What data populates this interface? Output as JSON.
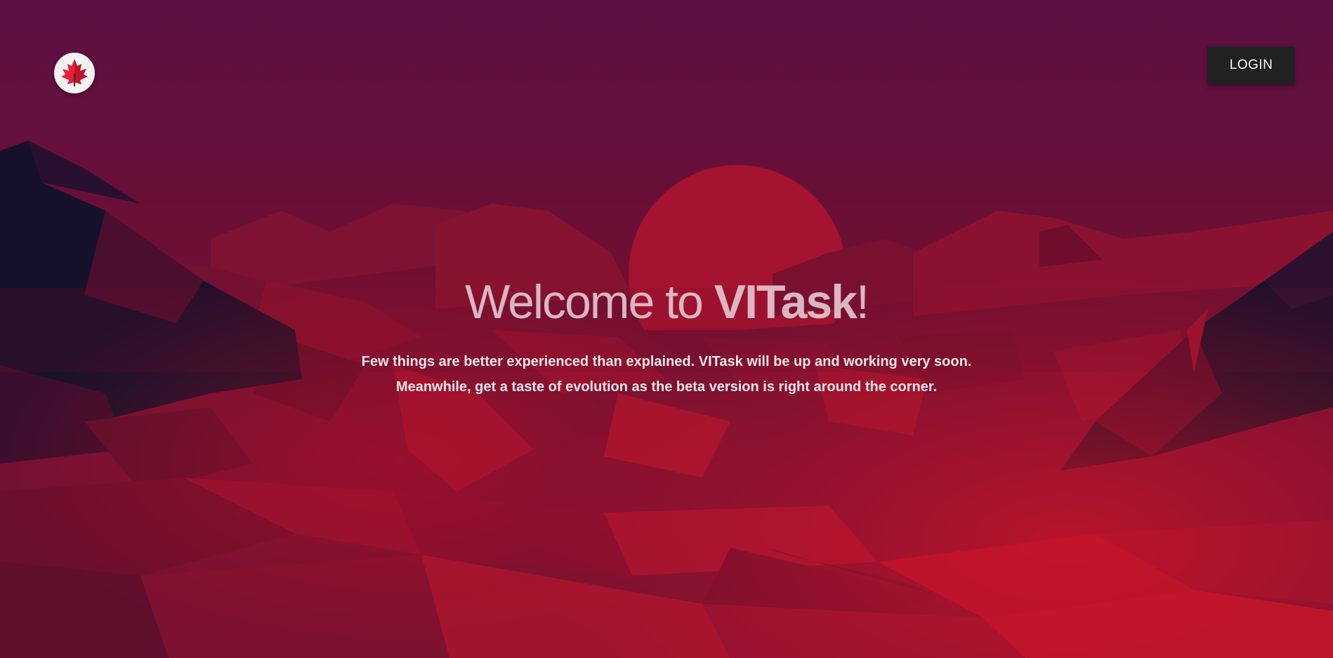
{
  "header": {
    "logo_icon": "maple-leaf-icon",
    "login_label": "LOGIN"
  },
  "hero": {
    "title_prefix": "Welcome to ",
    "title_brand": "VITask",
    "title_suffix": "!",
    "line1": "Few things are better experienced than explained. VITask will be up and working very soon.",
    "line2": "Meanwhile, get a taste of evolution as the beta version is right around the corner."
  },
  "colors": {
    "sky_top": "#5e1040",
    "sun": "#a8122e",
    "mountain_dark": "#14102a",
    "login_bg": "#212121"
  }
}
